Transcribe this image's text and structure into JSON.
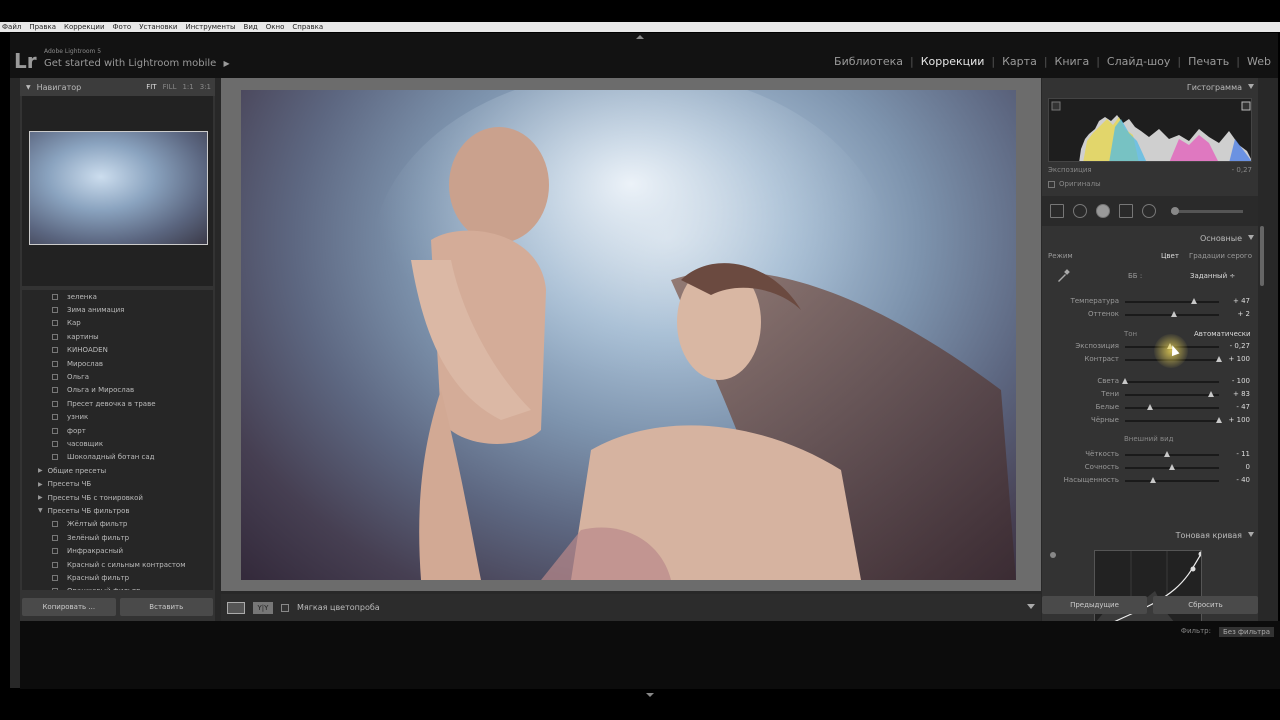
{
  "menubar": {
    "items": [
      "Файл",
      "Правка",
      "Коррекции",
      "Фото",
      "Установки",
      "Инструменты",
      "Вид",
      "Окно",
      "Справка"
    ]
  },
  "identity": {
    "logo": "Lr",
    "version": "Adobe Lightroom 5",
    "mobile": "Get started with Lightroom mobile"
  },
  "modules": [
    "Библиотека",
    "Коррекции",
    "Карта",
    "Книга",
    "Слайд-шоу",
    "Печать",
    "Web"
  ],
  "active_module": "Коррекции",
  "navigator": {
    "title": "Навигатор",
    "zoom": [
      "FIT",
      "FILL",
      "1:1",
      "3:1"
    ]
  },
  "presets": [
    {
      "label": "зеленка",
      "folder": false
    },
    {
      "label": "Зима анимация",
      "folder": false
    },
    {
      "label": "Кар",
      "folder": false
    },
    {
      "label": "картины",
      "folder": false
    },
    {
      "label": "КИНОADEN",
      "folder": false
    },
    {
      "label": "Мирослав",
      "folder": false
    },
    {
      "label": "Ольга",
      "folder": false
    },
    {
      "label": "Ольга и Мирослав",
      "folder": false
    },
    {
      "label": "Пресет девочка в траве",
      "folder": false
    },
    {
      "label": "узник",
      "folder": false
    },
    {
      "label": "форт",
      "folder": false
    },
    {
      "label": "часовщик",
      "folder": false
    },
    {
      "label": "Шоколадный ботан сад",
      "folder": false
    },
    {
      "label": "Общие пресеты",
      "folder": true,
      "tri": "▶"
    },
    {
      "label": "Пресеты ЧБ",
      "folder": true,
      "tri": "▶"
    },
    {
      "label": "Пресеты ЧБ с тонировкой",
      "folder": true,
      "tri": "▶"
    },
    {
      "label": "Пресеты ЧБ фильтров",
      "folder": true,
      "tri": "▼"
    },
    {
      "label": "Жёлтый фильтр",
      "folder": false
    },
    {
      "label": "Зелёный фильтр",
      "folder": false
    },
    {
      "label": "Инфракрасный",
      "folder": false
    },
    {
      "label": "Красный с сильным контрастом",
      "folder": false
    },
    {
      "label": "Красный фильтр",
      "folder": false
    },
    {
      "label": "Оранжевый фильтр",
      "folder": false
    }
  ],
  "left_buttons": {
    "copy": "Копировать ...",
    "paste": "Вставить"
  },
  "toolbar": {
    "soft_proof": "Мягкая цветопроба"
  },
  "histogram": {
    "title": "Гистограмма",
    "info_label": "Экспозиция",
    "info_value": "- 0,27",
    "originals": "Оригиналы"
  },
  "basic": {
    "title": "Основные",
    "mode_label": "Режим",
    "mode_color": "Цвет",
    "mode_bw": "Градации серого",
    "wb_label": "ББ :",
    "wb_value": "Заданный ÷",
    "tone_label": "Тон",
    "tone_auto": "Автоматически",
    "presence_label": "Внешний вид",
    "sliders": [
      {
        "label": "Температура",
        "value": "+ 47",
        "pos": 0.73
      },
      {
        "label": "Оттенок",
        "value": "+ 2",
        "pos": 0.52
      },
      {
        "label": "Экспозиция",
        "value": "- 0,27",
        "pos": 0.48
      },
      {
        "label": "Контраст",
        "value": "+ 100",
        "pos": 1.0
      },
      {
        "label": "Света",
        "value": "- 100",
        "pos": 0.0
      },
      {
        "label": "Тени",
        "value": "+ 83",
        "pos": 0.91
      },
      {
        "label": "Белые",
        "value": "- 47",
        "pos": 0.27
      },
      {
        "label": "Чёрные",
        "value": "+ 100",
        "pos": 1.0
      },
      {
        "label": "Чёткость",
        "value": "- 11",
        "pos": 0.45
      },
      {
        "label": "Сочность",
        "value": "0",
        "pos": 0.5
      },
      {
        "label": "Насыщенность",
        "value": "- 40",
        "pos": 0.3
      }
    ]
  },
  "tone_curve": {
    "title": "Тоновая кривая"
  },
  "right_buttons": {
    "previous": "Предыдущие",
    "reset": "Сбросить"
  },
  "filmstrip": {
    "filter_label": "Фильтр:",
    "filter_value": "Без фильтра"
  }
}
